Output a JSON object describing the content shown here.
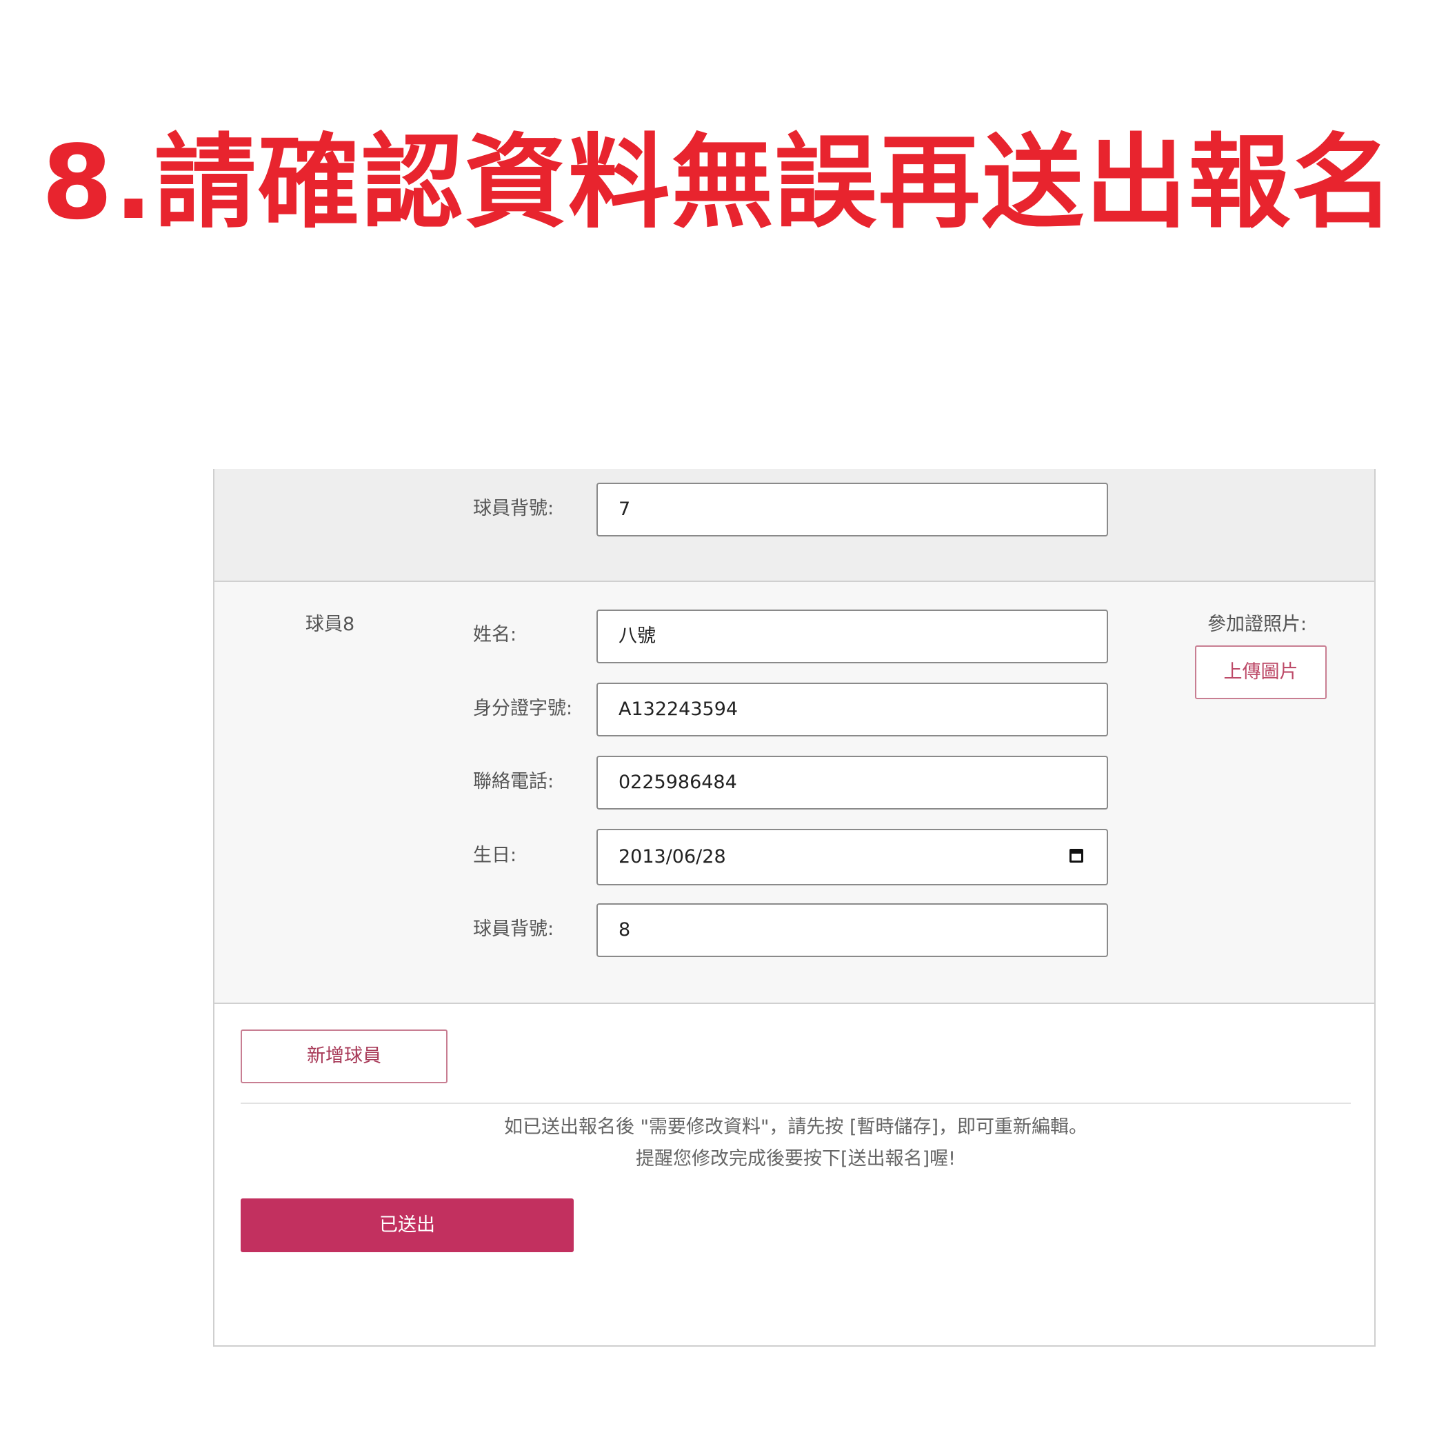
{
  "title": "8.請確認資料無誤再送出報名",
  "previous_player": {
    "jersey_label": "球員背號:",
    "jersey_value": "7"
  },
  "player": {
    "heading": "球員8",
    "name_label": "姓名:",
    "name_value": "八號",
    "id_label": "身分證字號:",
    "id_value": "A132243594",
    "phone_label": "聯絡電話:",
    "phone_value": "0225986484",
    "birthday_label": "生日:",
    "birthday_value": "2013/06/28",
    "jersey_label": "球員背號:",
    "jersey_value": "8",
    "photo_label": "參加證照片:",
    "upload_label": "上傳圖片"
  },
  "actions": {
    "add_player_label": "新增球員",
    "submitted_label": "已送出"
  },
  "notice": {
    "line1": "如已送出報名後 \"需要修改資料\"，請先按 [暫時儲存]，即可重新編輯。",
    "line2": "提醒您修改完成後要按下[送出報名]喔!"
  },
  "colors": {
    "title": "#e8242e",
    "accent": "#c2305f",
    "outline_button_border": "#c87e92"
  }
}
